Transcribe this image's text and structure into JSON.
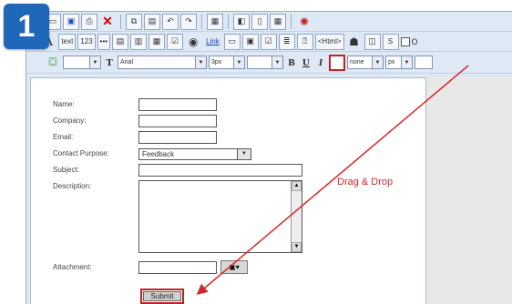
{
  "step_number": "1",
  "toolbar": {
    "row2": {
      "text_buttons": [
        "text",
        "123",
        "•••"
      ],
      "link_label": "Link",
      "html_label": "<Html>",
      "checkbox_partial_label": "O"
    },
    "row3": {
      "font_family": "Arial",
      "font_size": "3px",
      "bold": "B",
      "underline": "U",
      "italic": "I",
      "border_style": "none",
      "unit": "px"
    }
  },
  "form": {
    "fields": {
      "name_label": "Name:",
      "company_label": "Company:",
      "email_label": "Email:",
      "purpose_label": "Contact Purpose:",
      "purpose_value": "Feedback",
      "subject_label": "Subject:",
      "description_label": "Description:",
      "attachment_label": "Attachment:"
    },
    "submit_label": "Submit"
  },
  "annotation": {
    "drag_text": "Drag & Drop",
    "arrow_color": "#d7262b"
  },
  "colors": {
    "badge": "#1f67b8",
    "toolbar_bg": "#dfe8f5",
    "highlight": "#c42020"
  }
}
